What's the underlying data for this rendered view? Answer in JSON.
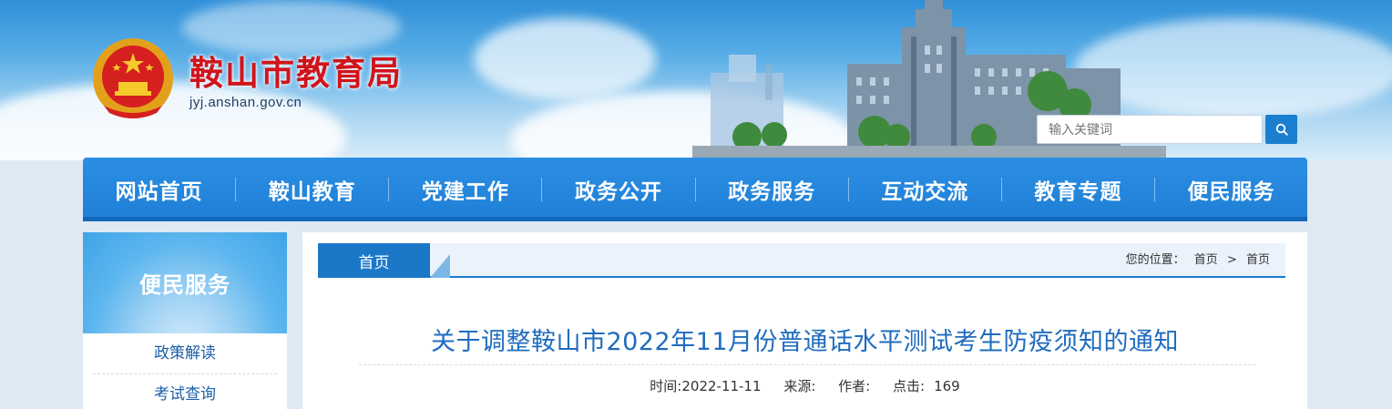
{
  "header": {
    "site_title": "鞍山市教育局",
    "site_domain": "jyj.anshan.gov.cn",
    "search_placeholder": "输入关键词",
    "search_icon": "search-icon"
  },
  "nav": {
    "items": [
      "网站首页",
      "鞍山教育",
      "党建工作",
      "政务公开",
      "政务服务",
      "互动交流",
      "教育专题",
      "便民服务"
    ]
  },
  "sidebar": {
    "heading": "便民服务",
    "links": [
      "政策解读",
      "考试查询"
    ]
  },
  "breadcrumb": {
    "tab_label": "首页",
    "location_label": "您的位置：",
    "path": [
      "首页",
      "首页"
    ],
    "separator": ">"
  },
  "article": {
    "title": "关于调整鞍山市2022年11月份普通话水平测试考生防疫须知的通知",
    "time": "时间:2022-11-11",
    "source": "来源:",
    "author": "作者:",
    "clicks_label": "点击:",
    "clicks_value": "169"
  },
  "colors": {
    "title_red": "#d0141c",
    "nav_blue": "#1f7fd6",
    "link_blue": "#1e5fa8",
    "article_title_blue": "#1f6cbf"
  }
}
